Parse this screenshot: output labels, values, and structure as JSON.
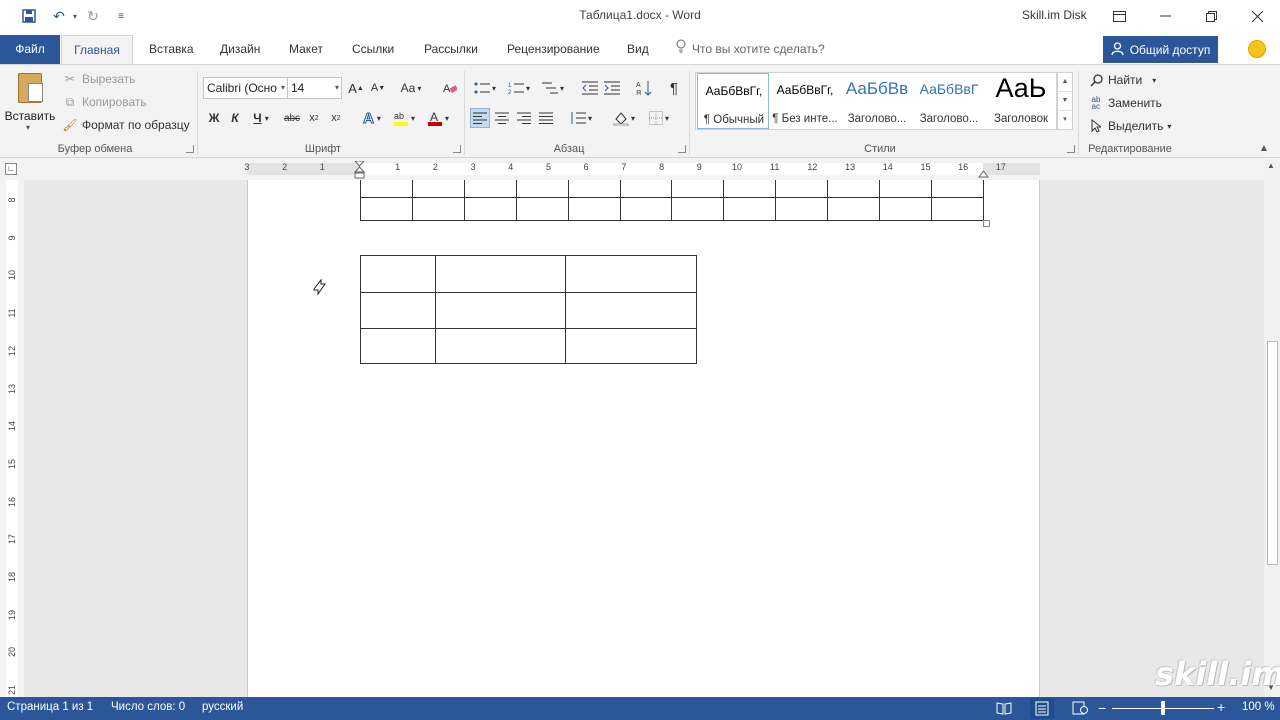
{
  "window": {
    "title": "Таблица1.docx - Word",
    "account": "Skill.im Disk"
  },
  "tabs": [
    {
      "label": "Файл"
    },
    {
      "label": "Главная"
    },
    {
      "label": "Вставка"
    },
    {
      "label": "Дизайн"
    },
    {
      "label": "Макет"
    },
    {
      "label": "Ссылки"
    },
    {
      "label": "Рассылки"
    },
    {
      "label": "Рецензирование"
    },
    {
      "label": "Вид"
    }
  ],
  "tell_me": "Что вы хотите сделать?",
  "share": "Общий доступ",
  "clipboard": {
    "paste": "Вставить",
    "cut": "Вырезать",
    "copy": "Копировать",
    "format_painter": "Формат по образцу",
    "group_label": "Буфер обмена"
  },
  "font": {
    "name": "Calibri (Осно",
    "size": "14",
    "group_label": "Шрифт",
    "bold_glyph": "Ж",
    "italic_glyph": "К",
    "underline_glyph": "Ч",
    "strike_glyph": "abc",
    "case_glyph": "Aa",
    "grow_glyph": "A",
    "shrink_glyph": "A",
    "highlight_color": "#ffff00",
    "font_color": "#c00000"
  },
  "paragraph": {
    "group_label": "Абзац",
    "pilcrow": "¶"
  },
  "styles": {
    "group_label": "Стили",
    "items": [
      {
        "preview": "АаБбВвГг,",
        "name": "¶ Обычный",
        "color": "#000000"
      },
      {
        "preview": "АаБбВвГг,",
        "name": "¶ Без инте...",
        "color": "#000000"
      },
      {
        "preview": "АаБбВв",
        "name": "Заголово...",
        "color": "#2e74b5"
      },
      {
        "preview": "АаБбВвГ",
        "name": "Заголово...",
        "color": "#2e74b5"
      },
      {
        "preview": "АаЬ",
        "name": "Заголовок",
        "color": "#000000"
      }
    ]
  },
  "editing": {
    "find": "Найти",
    "replace": "Заменить",
    "select": "Выделить",
    "group_label": "Редактирование"
  },
  "ruler": {
    "h_numbers": [
      "3",
      "2",
      "1",
      "1",
      "2",
      "3",
      "4",
      "5",
      "6",
      "7",
      "8",
      "9",
      "10",
      "11",
      "12",
      "13",
      "14",
      "15",
      "16",
      "17"
    ],
    "v_numbers": [
      "8",
      "9",
      "10",
      "11",
      "12",
      "13",
      "14",
      "15",
      "16",
      "17",
      "18",
      "19",
      "20",
      "21"
    ]
  },
  "document": {
    "table1": {
      "rows": 3,
      "cols": 12
    },
    "table2": {
      "rows": 3,
      "cols": 3
    }
  },
  "status": {
    "page": "Страница 1 из 1",
    "words": "Число слов: 0",
    "language": "русский",
    "zoom": "100 %",
    "zoom_level": 1.0
  },
  "watermark": "skill.im"
}
